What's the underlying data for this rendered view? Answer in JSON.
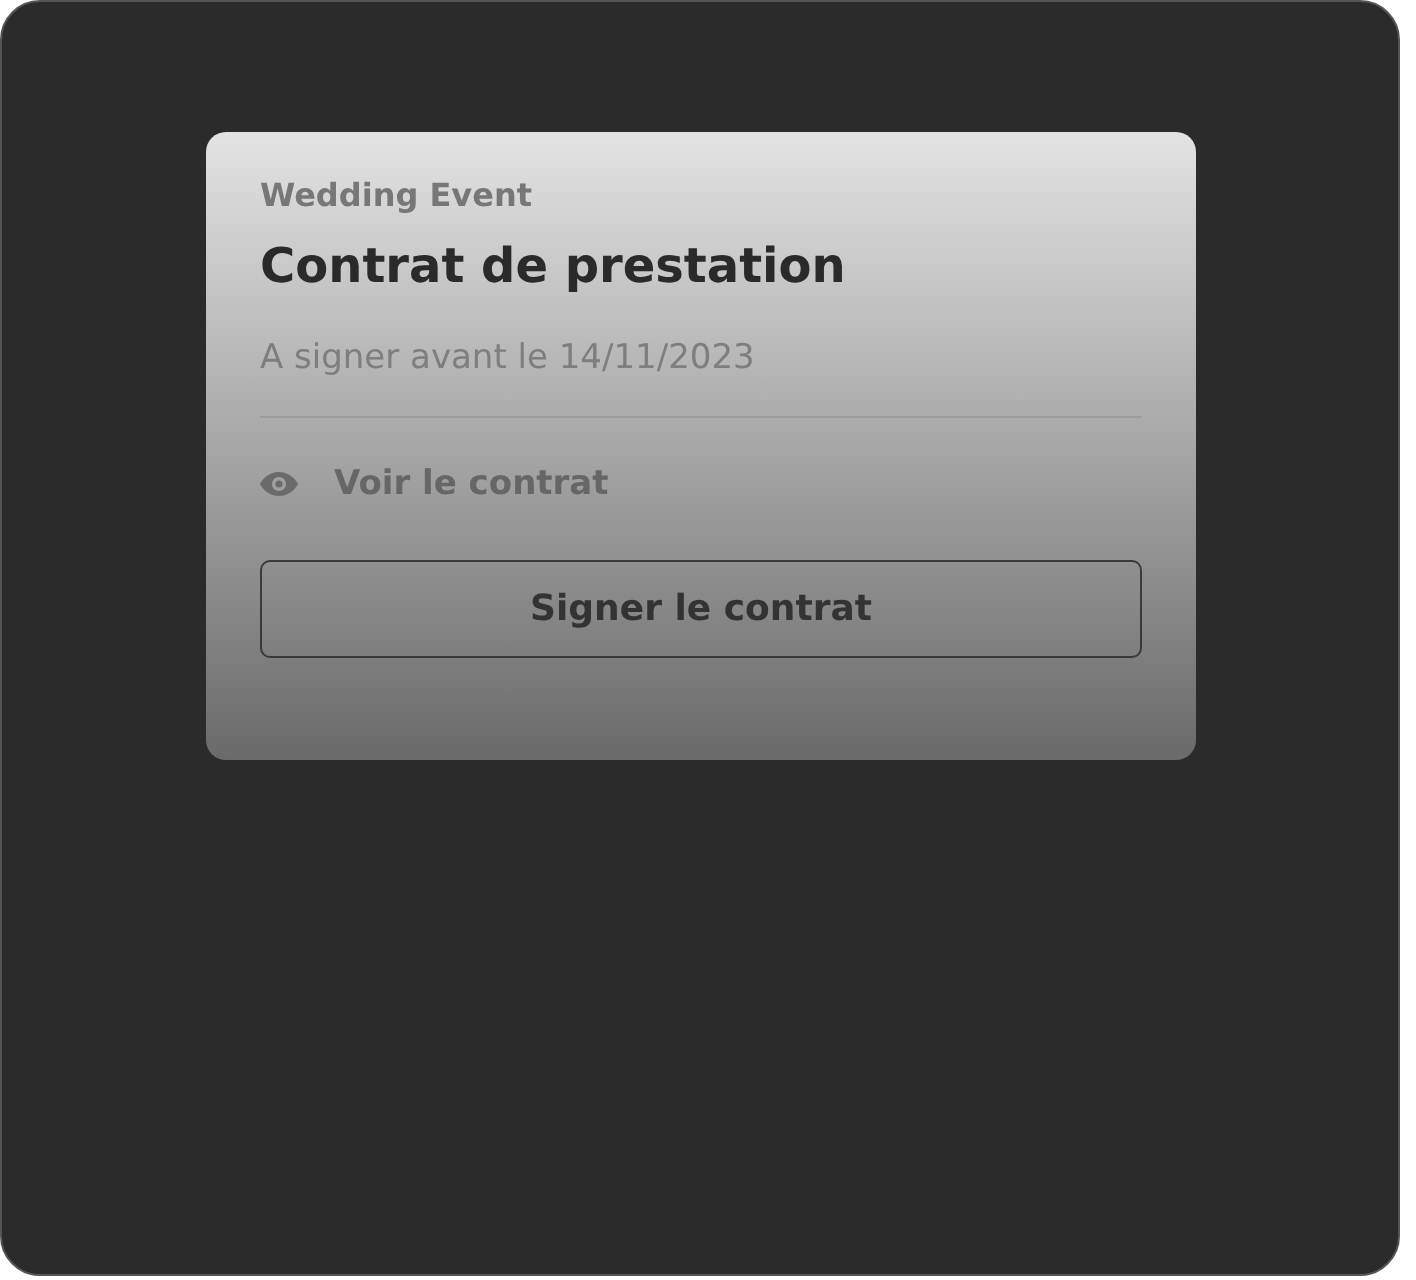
{
  "card": {
    "event": "Wedding Event",
    "title": "Contrat de prestation",
    "deadline": "A signer avant le 14/11/2023",
    "view_link": "Voir le contrat",
    "sign_button": "Signer le contrat"
  }
}
